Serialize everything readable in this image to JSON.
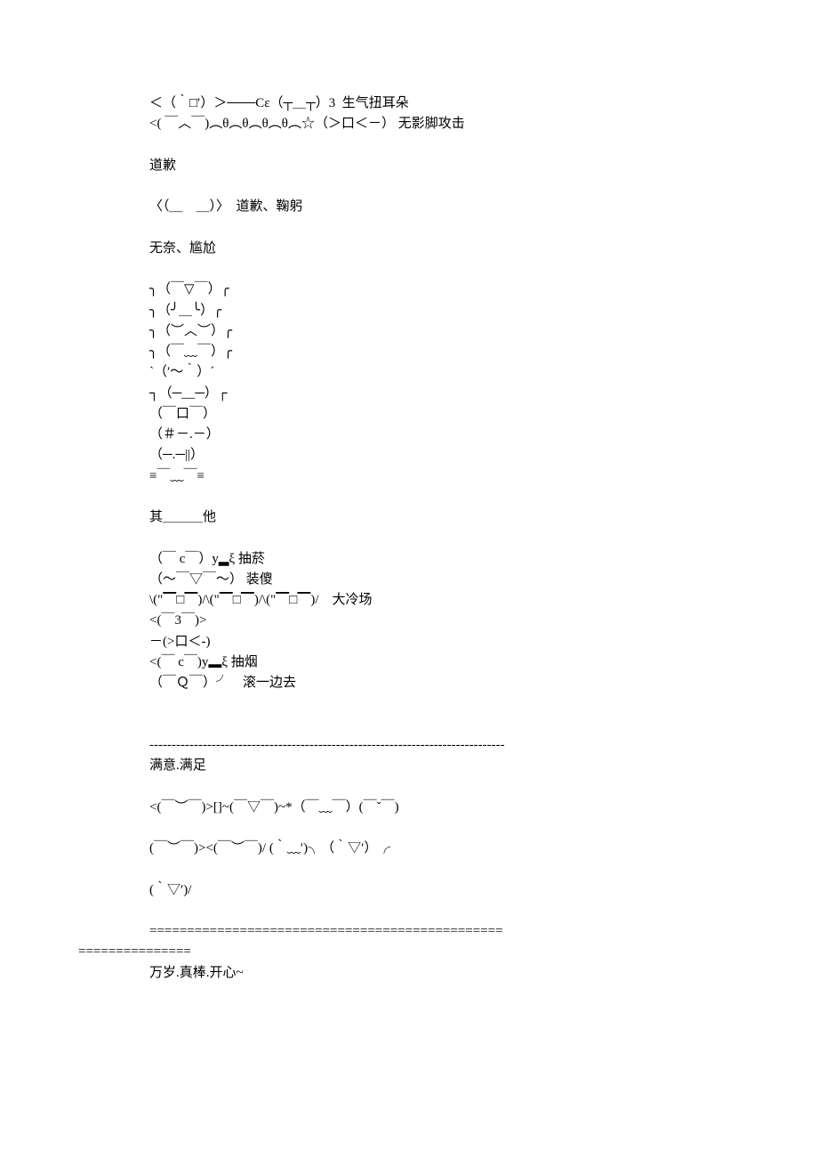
{
  "lines": [
    "＜（｀□′）＞───Cε（┬＿┬）3  生气扭耳朵",
    "<( ￣︿￣)︵θ︵θ︵θ︵θ︵☆（＞口＜－） 无影脚攻击",
    "",
    "道歉",
    "",
    "〈（＿　＿）〉　道歉、鞠躬",
    "",
    "无奈、尴尬",
    "",
    "╮（￣▽￣）╭",
    "╮（╯＿╰）╭",
    "╮（︶︿︶）╭",
    "╮（￣﹏￣）╭",
    "ˋ（′～｀）ˊ",
    "┐（─__─）┌",
    "（￣口￣）",
    "（＃－.－）",
    "（─.─||）",
    "≡￣﹏￣≡",
    "",
    "其＿＿＿他",
    "",
    "（￣ c￣）y▂ξ 抽菸",
    "（～￣▽￣～） 装傻",
    "\\(\"▔□▔)/\\(\"▔□▔)/\\(\"▔□▔)/　大冷场",
    "<(￣3￣)>",
    "－(>口＜-)",
    "<(￣ c￣)y▂ξ 抽烟",
    "（￣Ｑ￣）╯　滚一边去",
    "",
    "",
    "--------------------------------------------------------------------------------",
    "满意.满足",
    "",
    "<(￣︶￣)>[]~(￣▽￣)~*（￣﹏￣）(￣ˇ￣)",
    "",
    "(￣︶￣)><(￣︶￣)/ (｀﹏′)╮（｀▽′）╭",
    "",
    "(｀▽′)/",
    "",
    "==============================================="
  ],
  "outdentLine": "===============",
  "lastLine": "万岁.真棒.开心~"
}
